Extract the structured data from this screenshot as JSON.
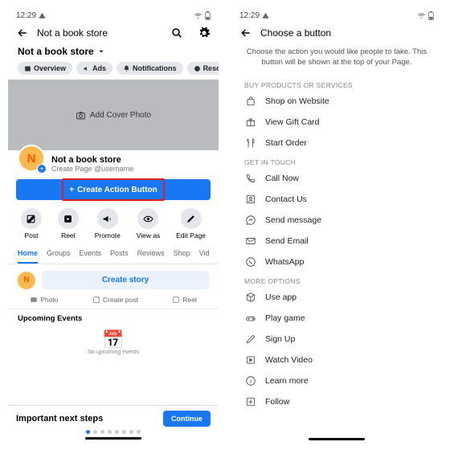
{
  "status": {
    "time": "12:29"
  },
  "left": {
    "header_title": "Not a book store",
    "page_name": "Not a book store",
    "chips": [
      "Overview",
      "Ads",
      "Notifications",
      "Resources &"
    ],
    "cover_label": "Add Cover Photo",
    "profile_initial": "N",
    "profile_name": "Not a book store",
    "profile_sub": "Create Page @username",
    "action_button": "Create Action Button",
    "quick_actions": [
      "Post",
      "Reel",
      "Promote",
      "View as",
      "Edit Page"
    ],
    "tabs": [
      "Home",
      "Groups",
      "Events",
      "Posts",
      "Reviews",
      "Shop",
      "Vid"
    ],
    "create_story": "Create story",
    "sub_actions": [
      "Photo",
      "Create post",
      "Reel"
    ],
    "upcoming": "Upcoming Events",
    "upcoming_sub": "No upcoming events",
    "next_steps": "Important next steps",
    "continue": "Continue"
  },
  "right": {
    "header_title": "Choose a button",
    "desc": "Choose the action you would like people to take. This button will be shown at the top of your Page.",
    "sections": {
      "buy": "BUY PRODUCTS OR SERVICES",
      "touch": "GET IN TOUCH",
      "more": "MORE OPTIONS"
    },
    "options": {
      "shop": "Shop on Website",
      "gift": "View Gift Card",
      "order": "Start Order",
      "call": "Call Now",
      "contact": "Contact Us",
      "message": "Send message",
      "email": "Send Email",
      "whatsapp": "WhatsApp",
      "app": "Use app",
      "game": "Play game",
      "signup": "Sign Up",
      "video": "Watch Video",
      "learn": "Learn more",
      "follow": "Follow"
    }
  }
}
